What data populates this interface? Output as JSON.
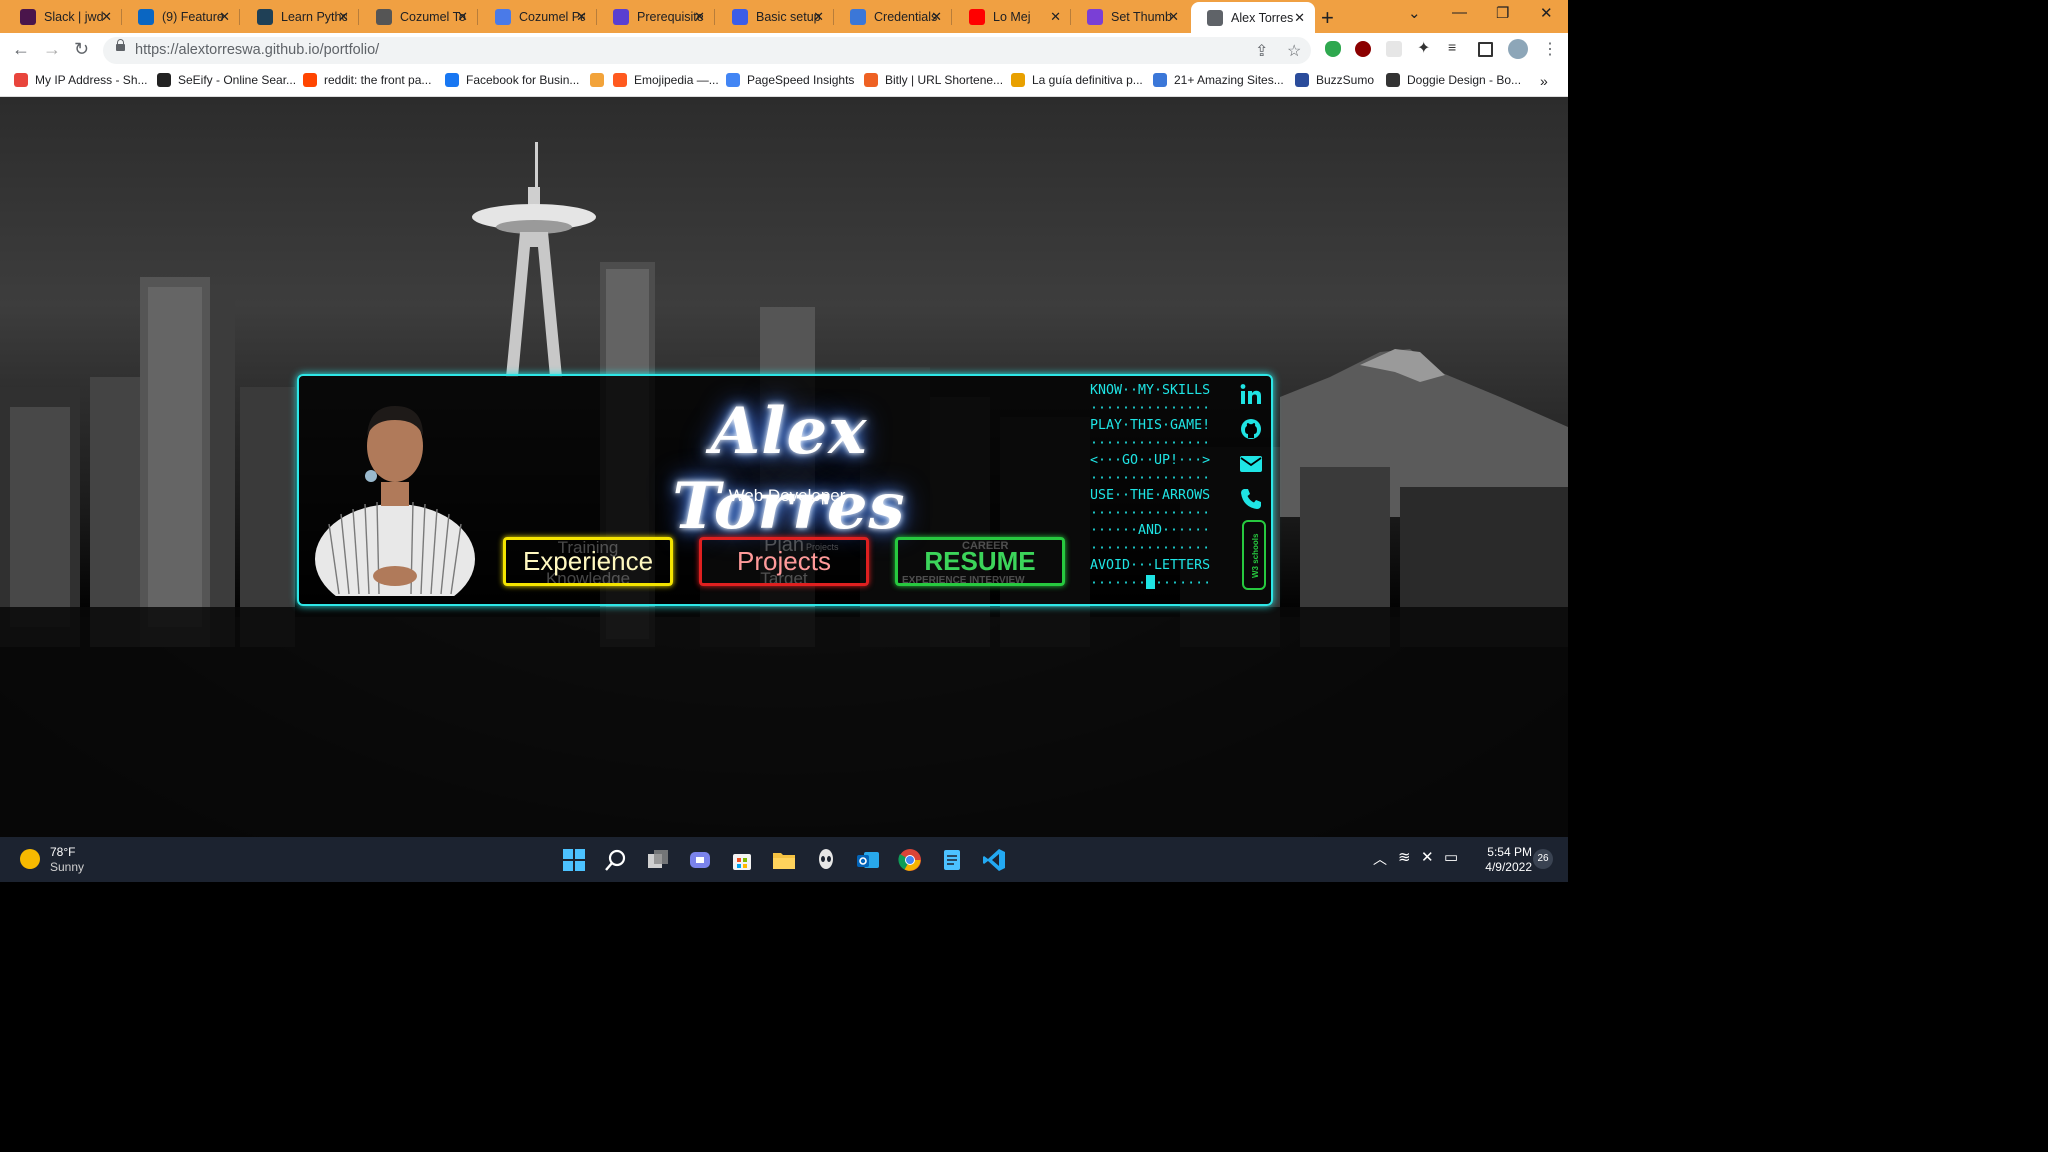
{
  "browser": {
    "tabs": [
      {
        "title": "Slack | jwd",
        "favicon": "slack-icon",
        "color": "#4a154b"
      },
      {
        "title": "(9) Feature",
        "favicon": "linkedin-icon",
        "color": "#0a66c2"
      },
      {
        "title": "Learn Pytho",
        "favicon": "codecademy-icon",
        "color": "#1f4056"
      },
      {
        "title": "Cozumel To",
        "favicon": "tripadvisor-icon",
        "color": "#555555"
      },
      {
        "title": "Cozumel Pa",
        "favicon": "doc-icon",
        "color": "#4a7ae8"
      },
      {
        "title": "Prerequisite",
        "favicon": "code-icon",
        "color": "#5a3fd1"
      },
      {
        "title": "Basic setup",
        "favicon": "code-icon",
        "color": "#3b5de8"
      },
      {
        "title": "Credentials",
        "favicon": "api-icon",
        "color": "#3b77d8"
      },
      {
        "title": "Lo Mej",
        "favicon": "youtube-icon",
        "color": "#ff0000"
      },
      {
        "title": "Set Thumb",
        "favicon": "image-icon",
        "color": "#7a3fd6"
      },
      {
        "title": "Alex Torres",
        "favicon": "globe-icon",
        "color": "#5f6368"
      }
    ],
    "url": "https://alextorreswa.github.io/portfolio/",
    "bookmarks": [
      {
        "label": "My IP Address - Sh...",
        "icon": "ip-icon",
        "color": "#e8453c"
      },
      {
        "label": "SeEify - Online Sear...",
        "icon": "seeify-icon",
        "color": "#222222"
      },
      {
        "label": "reddit: the front pa...",
        "icon": "reddit-icon",
        "color": "#ff4500"
      },
      {
        "label": "Facebook for Busin...",
        "icon": "meta-icon",
        "color": "#1877f2"
      },
      {
        "label": "",
        "icon": "extension-icon",
        "color": "#f2a33a"
      },
      {
        "label": "Emojipedia —...",
        "icon": "emojipedia-icon",
        "color": "#ff5a1f"
      },
      {
        "label": "PageSpeed Insights",
        "icon": "pagespeed-icon",
        "color": "#4285f4"
      },
      {
        "label": "Bitly | URL Shortene...",
        "icon": "bitly-icon",
        "color": "#ee6123"
      },
      {
        "label": "La guía definitiva p...",
        "icon": "guide-icon",
        "color": "#e8a000"
      },
      {
        "label": "21+ Amazing Sites...",
        "icon": "sites-icon",
        "color": "#3b77d8"
      },
      {
        "label": "BuzzSumo",
        "icon": "buzzsumo-icon",
        "color": "#2b4c9b"
      },
      {
        "label": "Doggie Design - Bo...",
        "icon": "paw-icon",
        "color": "#333333"
      }
    ]
  },
  "portfolio": {
    "name": "Alex Torres",
    "role": "Web Developer",
    "buttons": {
      "experience": {
        "label": "Experience",
        "ghost_top": "Training",
        "ghost_bottom": "Knowledge",
        "color": "#f4e400"
      },
      "projects": {
        "label": "Projects",
        "ghost_top": "Plan",
        "ghost_small": "Projects",
        "ghost_bottom": "Target",
        "color": "#e02020"
      },
      "resume": {
        "label": "RESUME",
        "ghost_top": "CAREER",
        "ghost_bottom": "EXPERIENCE INTERVIEW",
        "color": "#27c93f"
      }
    },
    "game_lines": [
      "KNOW··MY·SKILLS",
      "···············",
      "PLAY·THIS·GAME!",
      "···············",
      "<···GO··UP!···>",
      "···············",
      "USE··THE·ARROWS",
      "···············",
      "······AND······",
      "···············",
      "AVOID···LETTERS",
      "·······"
    ],
    "game_tail": "·······",
    "social": [
      "linkedin-icon",
      "github-icon",
      "email-icon",
      "phone-icon",
      "w3schools-certified-icon"
    ],
    "accent": "#2ee6e6"
  },
  "taskbar": {
    "weather_temp": "78°F",
    "weather_desc": "Sunny",
    "time": "5:54 PM",
    "date": "4/9/2022",
    "notifications": "26"
  }
}
